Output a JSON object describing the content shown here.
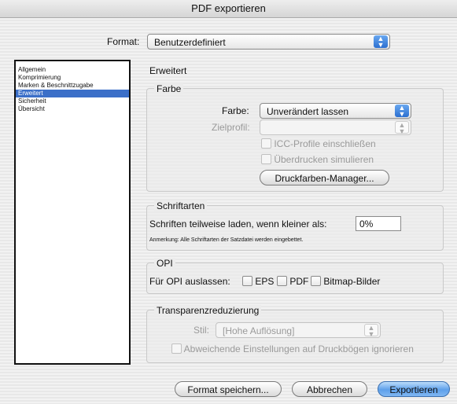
{
  "window": {
    "title": "PDF exportieren"
  },
  "format": {
    "label": "Format:",
    "value": "Benutzerdefiniert"
  },
  "sidebar": {
    "items": [
      {
        "label": "Allgemein"
      },
      {
        "label": "Komprimierung"
      },
      {
        "label": "Marken & Beschnittzugabe"
      },
      {
        "label": "Erweitert"
      },
      {
        "label": "Sicherheit"
      },
      {
        "label": "Übersicht"
      }
    ],
    "selected": "Erweitert"
  },
  "section": {
    "title": "Erweitert"
  },
  "farbe": {
    "group_title": "Farbe",
    "farbe_label": "Farbe:",
    "farbe_value": "Unverändert lassen",
    "zielprofil_label": "Zielprofil:",
    "zielprofil_value": "",
    "icc_label": "ICC-Profile einschließen",
    "ueberdrucken_label": "Überdrucken simulieren",
    "manager_button": "Druckfarben-Manager..."
  },
  "schriftarten": {
    "group_title": "Schriftarten",
    "teilweise_label": "Schriften teilweise laden, wenn kleiner als:",
    "teilweise_value": "0%",
    "note": "Anmerkung:  Alle Schriftarten der Satzdatei werden eingebettet."
  },
  "opi": {
    "group_title": "OPI",
    "auslassen_label": "Für OPI auslassen:",
    "eps_label": "EPS",
    "pdf_label": "PDF",
    "bitmap_label": "Bitmap-Bilder"
  },
  "transparenz": {
    "group_title": "Transparenzreduzierung",
    "stil_label": "Stil:",
    "stil_value": "[Hohe Auflösung]",
    "ignore_label": "Abweichende Einstellungen auf Druckbögen ignorieren"
  },
  "buttons": {
    "save": "Format speichern...",
    "cancel": "Abbrechen",
    "export": "Exportieren"
  }
}
